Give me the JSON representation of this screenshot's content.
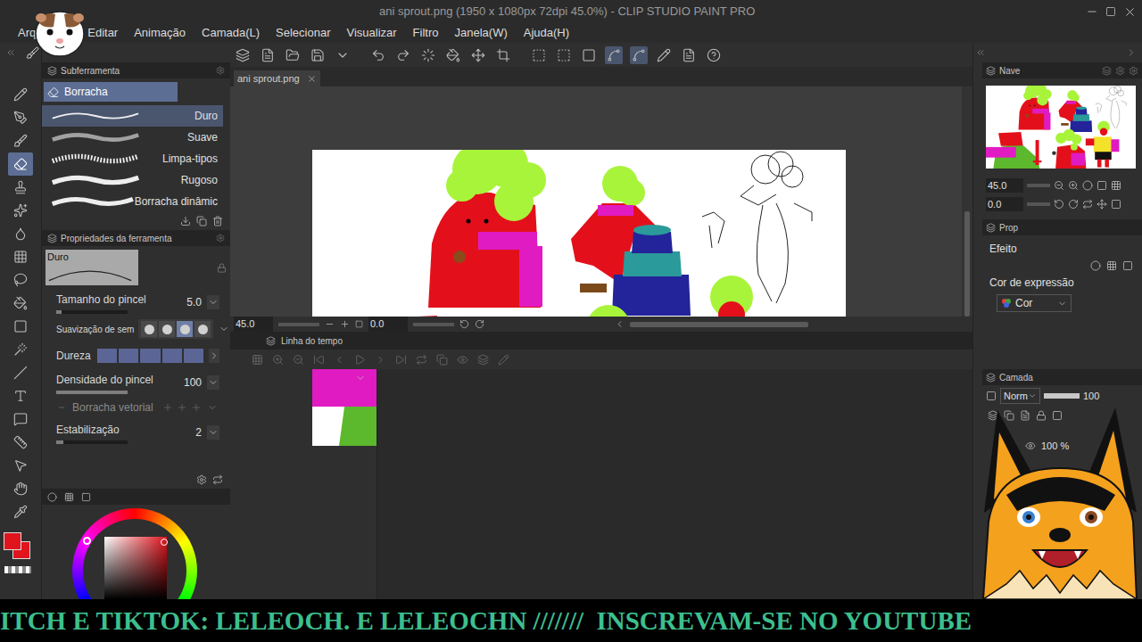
{
  "window": {
    "title": "ani sprout.png (1950 x 1080px 72dpi 45.0%) - CLIP STUDIO PAINT PRO"
  },
  "menu": [
    "Arq",
    "Editar",
    "Animação",
    "Camada(L)",
    "Selecionar",
    "Visualizar",
    "Filtro",
    "Janela(W)",
    "Ajuda(H)"
  ],
  "tool_strip": [
    {
      "selected": false
    },
    {
      "selected": false
    },
    {
      "selected": false
    },
    {
      "selected": true
    },
    {
      "selected": false
    },
    {
      "selected": false
    },
    {
      "selected": false
    },
    {
      "selected": false
    },
    {
      "selected": false
    },
    {
      "selected": false
    },
    {
      "selected": false
    },
    {
      "selected": false
    },
    {
      "selected": false
    },
    {
      "selected": false
    },
    {
      "selected": false
    },
    {
      "selected": false
    },
    {
      "selected": false
    },
    {
      "selected": false
    },
    {
      "selected": false
    }
  ],
  "sub_tool": {
    "header": "Subferramenta",
    "group": {
      "label": "Borracha",
      "selected": true
    },
    "items": [
      {
        "label": "Duro",
        "selected": true
      },
      {
        "label": "Suave",
        "selected": false
      },
      {
        "label": "Limpa-tipos",
        "selected": false
      },
      {
        "label": "Rugoso",
        "selected": false
      },
      {
        "label": "Borracha dinâmic",
        "selected": false
      }
    ]
  },
  "tool_properties": {
    "header": "Propriedades da ferramenta",
    "preview": "Duro",
    "rows": [
      {
        "kind": "slider",
        "label": "Tamanho do pincel",
        "value": "5.0",
        "level": 0.08
      },
      {
        "kind": "dots",
        "label": "Suavização de sem",
        "options": [
          {
            "selected": false
          },
          {
            "selected": false
          },
          {
            "selected": true
          },
          {
            "selected": false
          }
        ]
      },
      {
        "kind": "segments",
        "label": "Dureza",
        "steps": [
          {
            "on": true
          },
          {
            "on": true
          },
          {
            "on": true
          },
          {
            "on": true
          },
          {
            "on": true
          }
        ]
      },
      {
        "kind": "slider",
        "label": "Densidade do pincel",
        "value": "100",
        "level": 1
      },
      {
        "kind": "checkbox",
        "label": "Borracha vetorial",
        "checked": true,
        "disabled": true
      },
      {
        "kind": "slider",
        "label": "Estabilização",
        "value": "2",
        "level": 0.1
      }
    ]
  },
  "colors": {
    "main": "#e0141c",
    "sub": "#e0141c"
  },
  "document_tab": {
    "label": "ani sprout.png",
    "selected": true
  },
  "status_bar": {
    "zoom": "45.0",
    "rotation": "0.0"
  },
  "timeline": {
    "header": "Linha do tempo"
  },
  "navigator": {
    "tab": "Nave",
    "zoom": "45.0",
    "rotation": "0.0"
  },
  "properties": {
    "tab": "Prop",
    "effect_label": "Efeito",
    "expression_label": "Cor de expressão",
    "expression_value": "Cor"
  },
  "layers": {
    "tab": "Camada",
    "blend_mode": "Norm",
    "opacity": "100",
    "layer_opacity": "100 %"
  },
  "banner": {
    "text": "ITCH E TIKTOK: LELEOCH. E LELEOCHN ///////  INSCREVAM-SE NO YOUTUBE"
  }
}
